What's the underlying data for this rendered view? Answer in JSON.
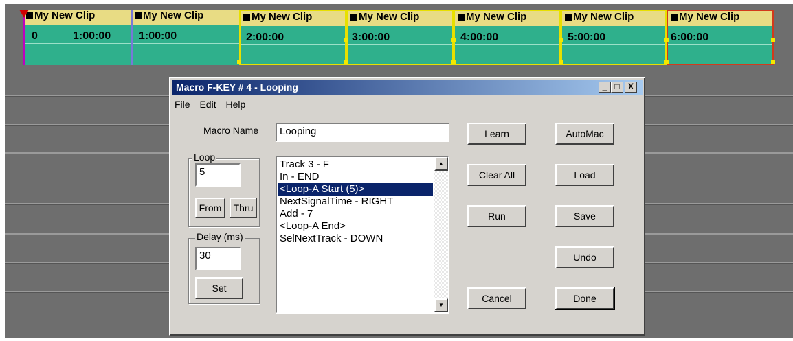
{
  "timeline": {
    "clips": [
      {
        "name": "My New Clip",
        "start": "0",
        "time": "1:00:00"
      },
      {
        "name": "My New Clip",
        "time": "1:00:00"
      },
      {
        "name": "My New Clip",
        "time": "2:00:00"
      },
      {
        "name": "My New Clip",
        "time": "3:00:00"
      },
      {
        "name": "My New Clip",
        "time": "4:00:00"
      },
      {
        "name": "My New Clip",
        "time": "5:00:00"
      },
      {
        "name": "My New Clip",
        "time": "6:00:00"
      }
    ]
  },
  "dialog": {
    "title": "Macro F-KEY # 4 - Looping",
    "title_buttons": {
      "minimize": "_",
      "maximize": "□",
      "close": "X"
    },
    "menu": [
      "File",
      "Edit",
      "Help"
    ],
    "macro_name_label": "Macro Name",
    "macro_name_value": "Looping",
    "loop_group": {
      "title": "Loop",
      "value": "5",
      "from_label": "From",
      "thru_label": "Thru"
    },
    "delay_group": {
      "title": "Delay (ms)",
      "value": "30",
      "set_label": "Set"
    },
    "list_items": [
      "Track 3 - F",
      "In - END",
      "<Loop-A Start (5)>",
      "NextSignalTime - RIGHT",
      "Add - 7",
      "<Loop-A End>",
      "SelNextTrack - DOWN"
    ],
    "selected_index": 2,
    "buttons": {
      "learn": "Learn",
      "automac": "AutoMac",
      "clear_all": "Clear All",
      "load": "Load",
      "run": "Run",
      "save": "Save",
      "undo": "Undo",
      "cancel": "Cancel",
      "done": "Done"
    }
  }
}
